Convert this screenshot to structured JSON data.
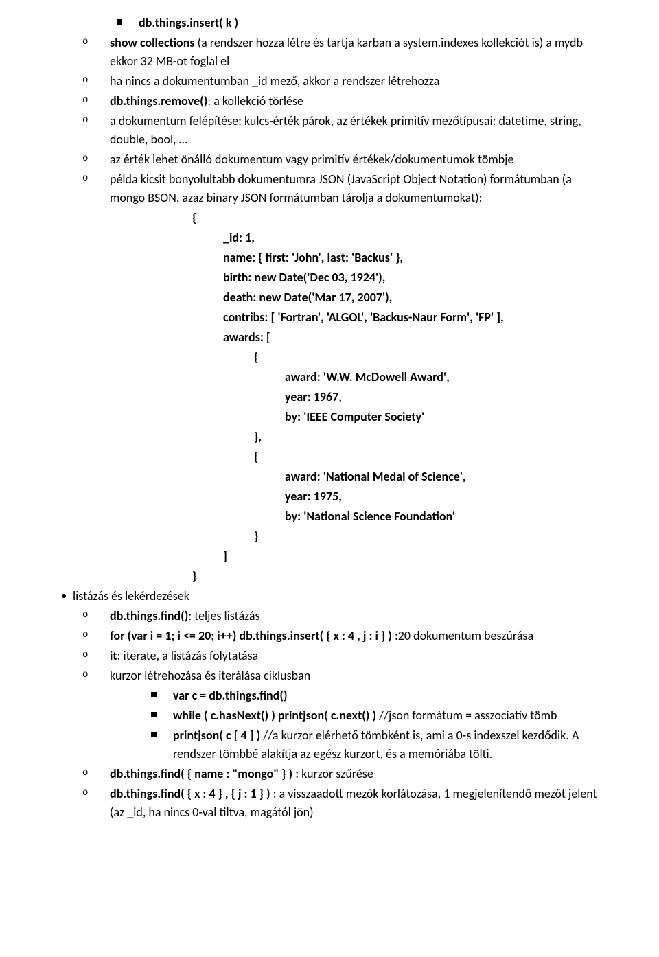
{
  "lines": [
    {
      "type": "sq",
      "indent": "indent-1",
      "html": "<b>db.things.insert( k )</b>"
    },
    {
      "type": "o",
      "indent": "indent-2",
      "html": "<b>show collections</b> (a rendszer hozza létre és tartja karban a system.indexes kollekciót is) a mydb ekkor 32 MB-ot foglal el"
    },
    {
      "type": "o",
      "indent": "indent-2",
      "html": "ha nincs a dokumentumban _id mező, akkor a rendszer létrehozza"
    },
    {
      "type": "o",
      "indent": "indent-2",
      "html": "<b>db.things.remove()</b>: a kollekció törlése"
    },
    {
      "type": "o",
      "indent": "indent-2",
      "html": "a dokumentum felépítése: kulcs-érték párok, az értékek primitív mezőtípusai: datetime, string, double, bool, …"
    },
    {
      "type": "o",
      "indent": "indent-2",
      "html": "az érték lehet önálló dokumentum vagy primitív értékek/dokumentumok tömbje"
    },
    {
      "type": "o",
      "indent": "indent-2",
      "html": "példa kicsit bonyolultabb dokumentumra JSON (JavaScript Object Notation) formátumban (a mongo BSON, azaz binary JSON formátumban tárolja a dokumentumokat):"
    },
    {
      "type": "code",
      "indent": "indent-code1",
      "html": "<b>{</b>"
    },
    {
      "type": "code",
      "indent": "indent-code2",
      "html": "<b>_id: 1,</b>"
    },
    {
      "type": "code",
      "indent": "indent-code2",
      "html": "<b>name: { first: 'John', last: 'Backus' },</b>"
    },
    {
      "type": "code",
      "indent": "indent-code2",
      "html": "<b>birth: new Date('Dec 03, 1924'),</b>"
    },
    {
      "type": "code",
      "indent": "indent-code2",
      "html": "<b>death: new Date('Mar 17, 2007'),</b>"
    },
    {
      "type": "code",
      "indent": "indent-code2",
      "html": "<b>contribs: [ 'Fortran', 'ALGOL', 'Backus-Naur Form', 'FP' ],</b>"
    },
    {
      "type": "code",
      "indent": "indent-code2",
      "html": "<b>awards: [</b>"
    },
    {
      "type": "code",
      "indent": "indent-code3",
      "html": "<b>{</b>"
    },
    {
      "type": "code",
      "indent": "indent-code4",
      "html": "<b>award: 'W.W. McDowell Award',</b>"
    },
    {
      "type": "code",
      "indent": "indent-code4",
      "html": "<b>year: 1967,</b>"
    },
    {
      "type": "code",
      "indent": "indent-code4",
      "html": "<b>by: 'IEEE Computer Society'</b>"
    },
    {
      "type": "code",
      "indent": "indent-code3",
      "html": "<b>},</b>"
    },
    {
      "type": "code",
      "indent": "indent-code3",
      "html": "<b>{</b>"
    },
    {
      "type": "code",
      "indent": "indent-code4",
      "html": "<b>award: 'National Medal of Science',</b>"
    },
    {
      "type": "code",
      "indent": "indent-code4",
      "html": "<b>year: 1975,</b>"
    },
    {
      "type": "code",
      "indent": "indent-code4",
      "html": "<b>by: 'National Science Foundation'</b>"
    },
    {
      "type": "code",
      "indent": "indent-code3",
      "html": "<b>}</b>"
    },
    {
      "type": "code",
      "indent": "indent-code2",
      "html": "<b>]</b>"
    },
    {
      "type": "code",
      "indent": "indent-code1",
      "html": "<b>}</b>"
    },
    {
      "type": "disc",
      "indent": "indent-3",
      "html": "listázás és lekérdezések"
    },
    {
      "type": "o",
      "indent": "indent-2",
      "html": "<b>db.things.find()</b>: teljes listázás"
    },
    {
      "type": "o",
      "indent": "indent-2",
      "html": "<b>for (var i = 1; i <= 20; i++) db.things.insert( { x : 4 , j : i } )</b> :20 dokumentum beszúrása"
    },
    {
      "type": "o",
      "indent": "indent-2",
      "html": "<b>it</b>: iterate, a listázás folytatása"
    },
    {
      "type": "o",
      "indent": "indent-2",
      "html": "kurzor létrehozása és iterálása ciklusban"
    },
    {
      "type": "sq",
      "indent": "indent-sq2",
      "html": "<b>var c = db.things.find()</b>"
    },
    {
      "type": "sq",
      "indent": "indent-sq2",
      "html": "<b>while ( c.hasNext() ) printjson( c.next() )</b> //json formátum = asszociatív tömb"
    },
    {
      "type": "sq",
      "indent": "indent-sq2",
      "html": "<b>printjson( c [ 4 ] )</b> //a kurzor elérhető tömbként is, ami a 0-s indexszel kezdődik. A rendszer tömbbé alakítja az egész kurzort, és a memóriába tölti."
    },
    {
      "type": "o",
      "indent": "indent-2",
      "html": "<b>db.things.find( { name : \"mongo\" } )</b> : kurzor szűrése"
    },
    {
      "type": "o",
      "indent": "indent-2",
      "html": "<b>db.things.find( { x : 4 } , { j : 1 } )</b> : a visszaadott mezők korlátozása, 1 megjelenítendő mezőt jelent (az _id, ha nincs 0-val tiltva, magától jön)"
    }
  ]
}
